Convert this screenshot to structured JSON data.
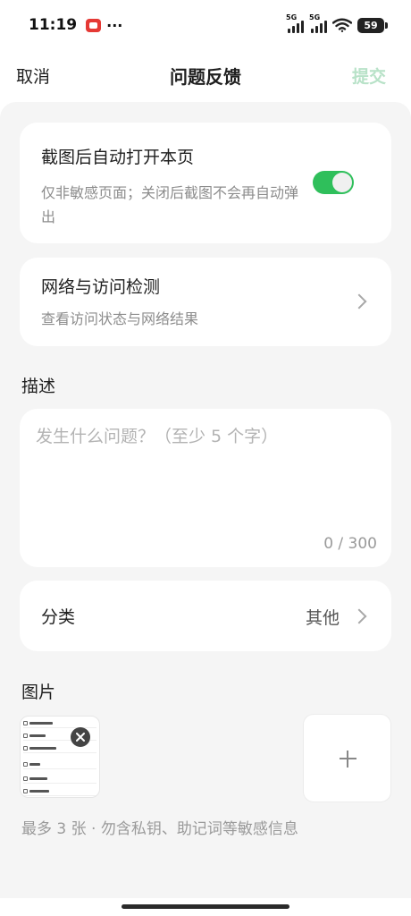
{
  "status_bar": {
    "time": "11:19",
    "dots": "···",
    "network1": "5G",
    "network2": "5G",
    "battery": "59"
  },
  "nav": {
    "cancel": "取消",
    "title": "问题反馈",
    "submit": "提交",
    "submit_color": "#b8e2c8"
  },
  "auto_open": {
    "title": "截图后自动打开本页",
    "subtitle": "仅非敏感页面；关闭后截图不会再自动弹出",
    "toggle_on": true,
    "toggle_color": "#2fbf5b"
  },
  "network_check": {
    "title": "网络与访问检测",
    "subtitle": "查看访问状态与网络结果"
  },
  "description": {
    "label": "描述",
    "placeholder": "发生什么问题？（至少 5 个字）",
    "value": "",
    "counter": "0 / 300"
  },
  "category": {
    "label": "分类",
    "value": "其他"
  },
  "images": {
    "label": "图片",
    "note": "最多 3 张 · 勿含私钥、助记词等敏感信息",
    "remove_icon": "close-icon",
    "add_icon": "plus-icon"
  }
}
